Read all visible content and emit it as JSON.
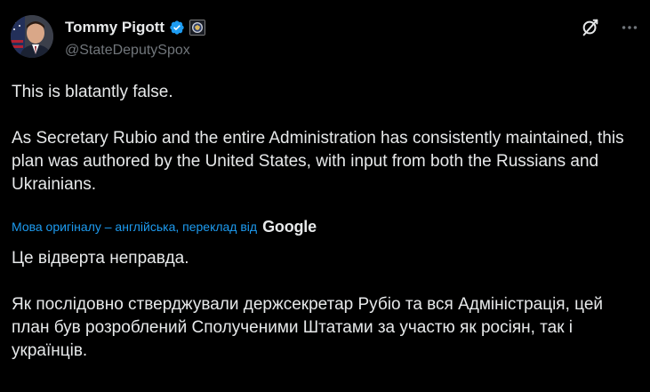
{
  "author": {
    "display_name": "Tommy Pigott",
    "handle": "@StateDeputySpox",
    "verified": true,
    "verified_color": "#1d9bf0",
    "affiliation_badge": "us-state-department-seal"
  },
  "actions": {
    "grok_icon": "grok-icon",
    "more_icon": "more-icon"
  },
  "tweet": {
    "original_text": "This is blatantly false.\n\nAs Secretary Rubio and the entire Administration has consistently maintained, this plan was authored by the United States, with input from both the Russians and Ukrainians.",
    "translation_note": "Мова оригіналу – англійська, переклад від",
    "translation_provider": "Google",
    "translated_text": "Це відверта неправда.\n\nЯк послідовно стверджували держсекретар Рубіо та вся Адміністрація, цей план був розроблений Сполученими Штатами за участю як росіян, так і українців."
  },
  "colors": {
    "background": "#000000",
    "text": "#e7e9ea",
    "secondary": "#71767b",
    "accent": "#1d9bf0"
  }
}
